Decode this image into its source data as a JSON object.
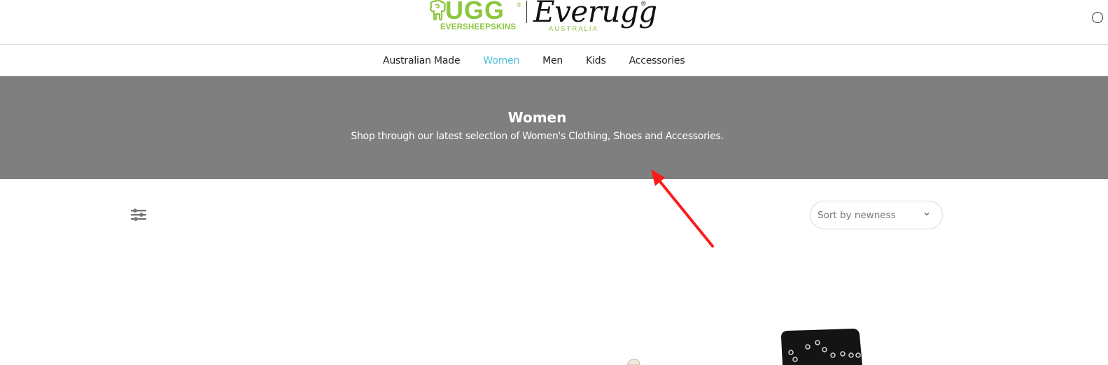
{
  "logo": {
    "ugg": "UGG",
    "ugg_reg": "®",
    "eversheepskins": "EVERSHEEPSKINS",
    "everugg": "Everugg",
    "everugg_reg": "®",
    "australia": "AUSTRALIA"
  },
  "nav": {
    "items": [
      {
        "label": "Australian Made",
        "active": false
      },
      {
        "label": "Women",
        "active": true
      },
      {
        "label": "Men",
        "active": false
      },
      {
        "label": "Kids",
        "active": false
      },
      {
        "label": "Accessories",
        "active": false
      }
    ]
  },
  "hero": {
    "title": "Women",
    "subtitle": "Shop through our latest selection of Women's Clothing, Shoes and Accessories."
  },
  "toolbar": {
    "filter_icon": "sliders-icon",
    "sort_selected": "Sort by newness"
  },
  "colors": {
    "brand_green": "#8cc63f",
    "nav_active": "#4dbfd9",
    "hero_bg": "#7f7f7f",
    "annotation_red": "#ff1a1a"
  }
}
